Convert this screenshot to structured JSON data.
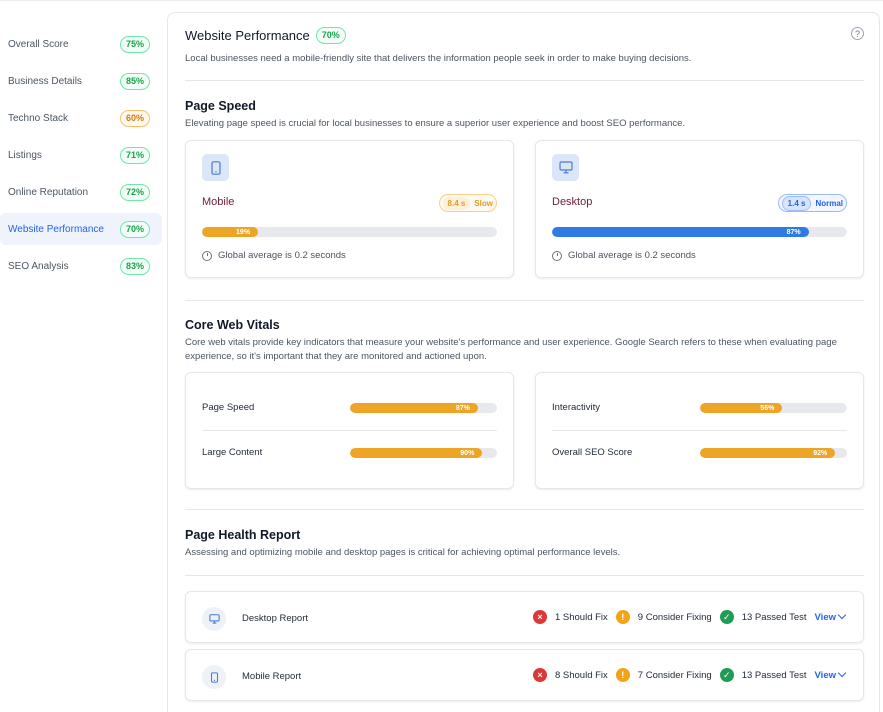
{
  "sidebar": {
    "items": [
      {
        "label": "Overall Score",
        "score": "75%",
        "tone": "green"
      },
      {
        "label": "Business Details",
        "score": "85%",
        "tone": "green"
      },
      {
        "label": "Techno Stack",
        "score": "60%",
        "tone": "orange"
      },
      {
        "label": "Listings",
        "score": "71%",
        "tone": "green"
      },
      {
        "label": "Online Reputation",
        "score": "72%",
        "tone": "green"
      },
      {
        "label": "Website Performance",
        "score": "70%",
        "tone": "green",
        "active": true
      },
      {
        "label": "SEO Analysis",
        "score": "83%",
        "tone": "green"
      }
    ]
  },
  "header": {
    "title": "Website Performance",
    "score": "70%",
    "description": "Local businesses need a mobile-friendly site that delivers the information people seek in order to make buying decisions.",
    "help_icon": "?"
  },
  "page_speed": {
    "title": "Page Speed",
    "description": "Elevating page speed is crucial for local businesses to ensure a superior user experience and boost SEO performance.",
    "mobile": {
      "name": "Mobile",
      "time": "8.4 s",
      "rating": "Slow",
      "percent_label": "19%",
      "percent": 19,
      "global": "Global average is 0.2 seconds",
      "icon": "phone-icon"
    },
    "desktop": {
      "name": "Desktop",
      "time": "1.4 s",
      "rating": "Normal",
      "percent_label": "87%",
      "percent": 87,
      "global": "Global average is 0.2 seconds",
      "icon": "monitor-icon"
    }
  },
  "core_web_vitals": {
    "title": "Core Web Vitals",
    "description": "Core web vitals provide key indicators that measure your website's performance and user experience. Google Search refers to these when evaluating page experience, so it's important that they are monitored and actioned upon.",
    "left": [
      {
        "label": "Page Speed",
        "percent_label": "87%",
        "percent": 87
      },
      {
        "label": "Large Content",
        "percent_label": "90%",
        "percent": 90
      }
    ],
    "right": [
      {
        "label": "Interactivity",
        "percent_label": "56%",
        "percent": 56
      },
      {
        "label": "Overall SEO Score",
        "percent_label": "92%",
        "percent": 92
      }
    ]
  },
  "page_health": {
    "title": "Page Health Report",
    "description": "Assessing and optimizing mobile and desktop pages is critical for achieving optimal performance levels.",
    "reports": [
      {
        "name": "Desktop Report",
        "should_fix": "1 Should Fix",
        "consider": "9 Consider Fixing",
        "passed": "13 Passed Test",
        "view": "View",
        "icon": "monitor-icon"
      },
      {
        "name": "Mobile Report",
        "should_fix": "8 Should Fix",
        "consider": "7 Consider Fixing",
        "passed": "13 Passed Test",
        "view": "View",
        "icon": "phone-icon"
      }
    ]
  },
  "colors": {
    "accent_blue": "#2563eb",
    "bar_orange": "#eea526",
    "bar_blue": "#2f7be6",
    "success": "#16a34a",
    "warning": "#d97706",
    "danger": "#dc3838"
  }
}
